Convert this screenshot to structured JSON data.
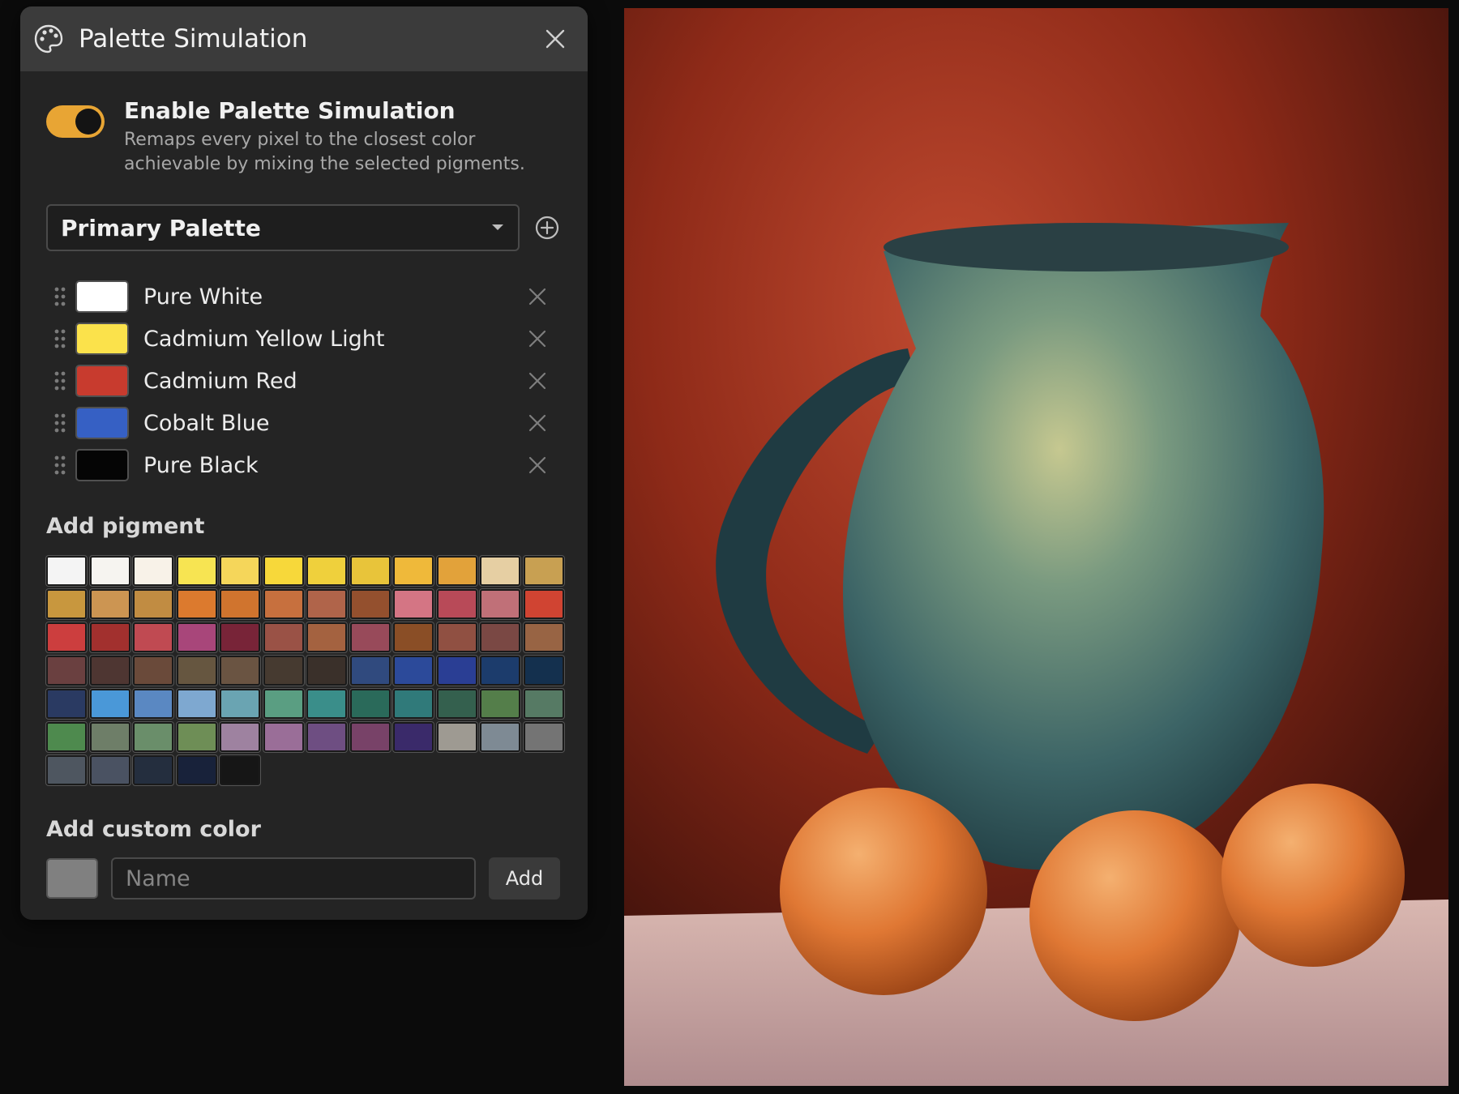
{
  "panel": {
    "title": "Palette Simulation",
    "toggle": {
      "title": "Enable Palette Simulation",
      "description": "Remaps every pixel to the closest color achievable by mixing the selected pigments.",
      "enabled": true,
      "color": "#e8a534"
    },
    "palette_select": {
      "value": "Primary Palette"
    },
    "pigments": [
      {
        "name": "Pure White",
        "color": "#ffffff"
      },
      {
        "name": "Cadmium Yellow Light",
        "color": "#fbe24b"
      },
      {
        "name": "Cadmium Red",
        "color": "#c83b2e"
      },
      {
        "name": "Cobalt Blue",
        "color": "#3660c4"
      },
      {
        "name": "Pure Black",
        "color": "#050505"
      }
    ],
    "add_pigment": {
      "title": "Add pigment",
      "swatches": [
        "#f4f4f4",
        "#f6f4f0",
        "#f8f2e8",
        "#f7e452",
        "#f5d65a",
        "#f7d83a",
        "#efd03c",
        "#e8c43a",
        "#efb93a",
        "#e2a23a",
        "#e6cfa3",
        "#c8a052",
        "#c8973e",
        "#cc9552",
        "#c18c42",
        "#dc7a2e",
        "#d0742e",
        "#c7703e",
        "#b0644a",
        "#94502e",
        "#d47584",
        "#b84a58",
        "#c07078",
        "#d04432",
        "#cc3e3e",
        "#a2302e",
        "#c04a52",
        "#a8467a",
        "#782438",
        "#9a5246",
        "#a46240",
        "#984a5a",
        "#8a4e26",
        "#905042",
        "#7a4844",
        "#986444",
        "#6a4040",
        "#4e3632",
        "#6a4a3a",
        "#665640",
        "#6a5442",
        "#463a30",
        "#3a302a",
        "#304a7e",
        "#2c4a9a",
        "#2a3e94",
        "#1c3c6c",
        "#14304e",
        "#2a3a62",
        "#4a98d8",
        "#5a88c2",
        "#7ea8d0",
        "#6aa4b2",
        "#5a9e82",
        "#3a8e8a",
        "#2a6a5a",
        "#307a7a",
        "#34604e",
        "#547e4a",
        "#567a64",
        "#4e8a4e",
        "#6e7e68",
        "#6a8e6a",
        "#6e8e56",
        "#9e82a0",
        "#9a6e98",
        "#6e4e82",
        "#784268",
        "#3a2a6a",
        "#9e9a92",
        "#7e8a94",
        "#747474",
        "#4e5660",
        "#4a5262",
        "#242e3e",
        "#18223a",
        "#161616"
      ]
    },
    "custom_color": {
      "title": "Add custom color",
      "swatch_color": "#808080",
      "name_placeholder": "Name",
      "add_label": "Add"
    }
  },
  "canvas": {
    "subject": "still-life-pitcher-oranges"
  }
}
